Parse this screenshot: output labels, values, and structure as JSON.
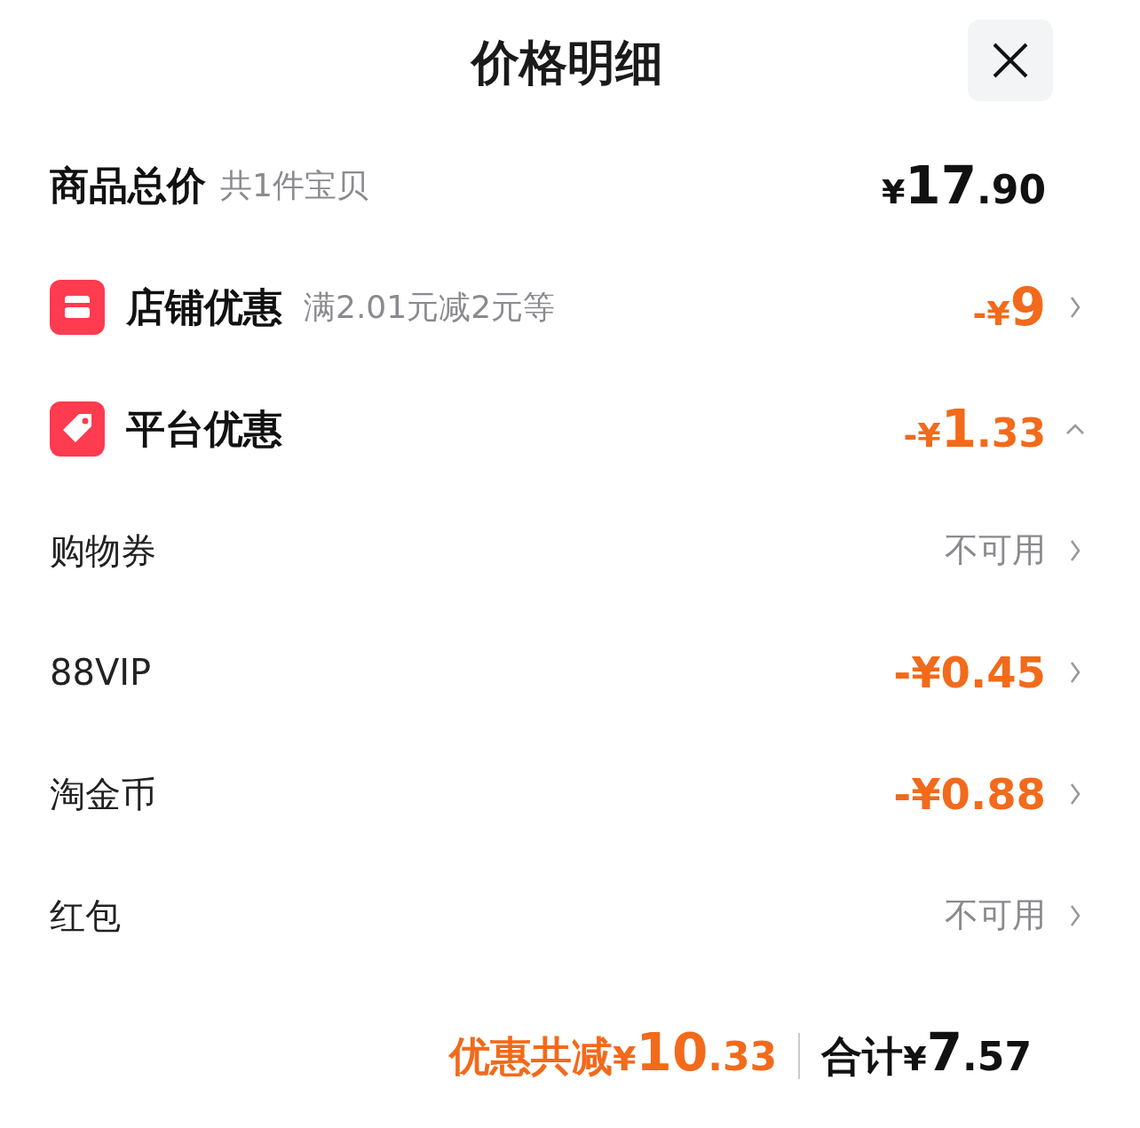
{
  "title": "价格明细",
  "total": {
    "label": "商品总价",
    "note": "共1件宝贝",
    "amount": {
      "prefix": "¥",
      "integer": "17",
      "decimal": ".90"
    }
  },
  "sections": [
    {
      "kind": "store",
      "label": "店铺优惠",
      "note": "满2.01元减2元等",
      "amount": {
        "prefix": "-¥",
        "integer": "9"
      },
      "expanded": false
    },
    {
      "kind": "tag",
      "label": "平台优惠",
      "amount": {
        "prefix": "-¥",
        "integer": "1",
        "decimal": ".33"
      },
      "expanded": true,
      "children": [
        {
          "label": "购物券",
          "value": "不可用",
          "kind": "unavailable"
        },
        {
          "label": "88VIP",
          "value": "-¥0.45",
          "kind": "discount"
        },
        {
          "label": "淘金币",
          "value": "-¥0.88",
          "kind": "discount"
        },
        {
          "label": "红包",
          "value": "不可用",
          "kind": "unavailable"
        }
      ]
    }
  ],
  "footer": {
    "saving_label": "优惠共减",
    "saving": {
      "prefix": "¥",
      "integer": "10",
      "decimal": ".33"
    },
    "total_label": "合计",
    "total": {
      "prefix": "¥",
      "integer": "7",
      "decimal": ".57"
    }
  }
}
